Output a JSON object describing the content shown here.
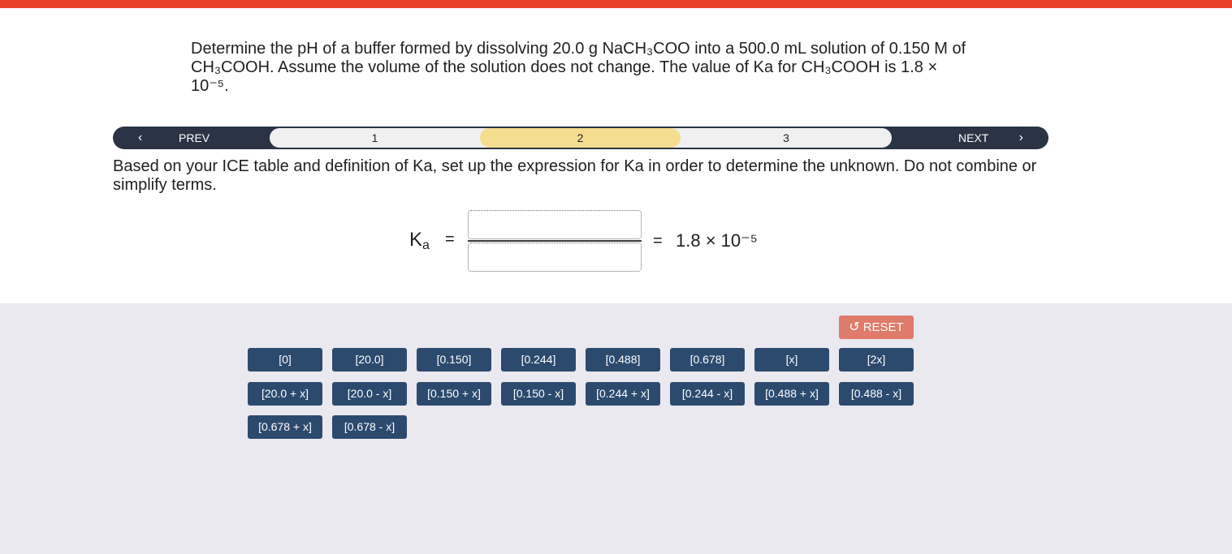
{
  "question": "Determine the pH of a buffer formed by dissolving 20.0 g NaCH₃COO into a 500.0 mL solution of 0.150 M of CH₃COOH. Assume the volume of the solution does not change. The value of Ka for CH₃COOH is 1.8 × 10⁻⁵.",
  "nav": {
    "prev_label": "PREV",
    "next_label": "NEXT",
    "steps": [
      "1",
      "2",
      "3"
    ],
    "active_step": "2"
  },
  "instruction": "Based on your ICE table and definition of Ka, set up the expression for Ka in order to determine the unknown. Do not combine or simplify terms.",
  "equation": {
    "ka_symbol": "K",
    "ka_sub": "a",
    "equals": "=",
    "result": "1.8 × 10⁻⁵"
  },
  "reset_label": "RESET",
  "tiles": [
    "[0]",
    "[20.0]",
    "[0.150]",
    "[0.244]",
    "[0.488]",
    "[0.678]",
    "[x]",
    "[2x]",
    "[20.0 + x]",
    "[20.0 - x]",
    "[0.150 + x]",
    "[0.150 - x]",
    "[0.244 + x]",
    "[0.244 - x]",
    "[0.488 + x]",
    "[0.488 - x]",
    "[0.678 + x]",
    "[0.678 - x]"
  ],
  "colors": {
    "top_bar": "#e8412a",
    "nav_bg": "#2b3445",
    "active_step": "#f5dd8f",
    "tile_bg": "#2c4a6e",
    "reset_bg": "#e07a6a",
    "tray_bg": "#e9e9ef"
  }
}
